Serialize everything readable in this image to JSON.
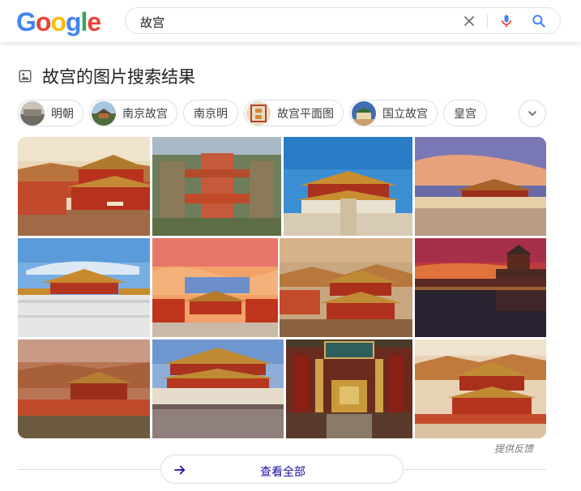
{
  "logo": {
    "letters": [
      "G",
      "o",
      "o",
      "g",
      "l",
      "e"
    ],
    "colors": [
      "#4285F4",
      "#EA4335",
      "#FBBC05",
      "#4285F4",
      "#34A853",
      "#EA4335"
    ]
  },
  "search": {
    "query": "故宫"
  },
  "section": {
    "title": "故宫的图片搜索结果"
  },
  "chips": [
    {
      "label": "明朝",
      "has_thumb": true
    },
    {
      "label": "南京故宫",
      "has_thumb": true
    },
    {
      "label": "南京明",
      "has_thumb": false
    },
    {
      "label": "故宫平面图",
      "has_thumb": true
    },
    {
      "label": "国立故宫",
      "has_thumb": true
    },
    {
      "label": "皇宫",
      "has_thumb": false
    }
  ],
  "images": {
    "plaque_text": "皇極建有"
  },
  "footer": {
    "feedback": "提供反馈",
    "view_all": "查看全部"
  },
  "colors": {
    "link": "#1a0dab",
    "border": "#dadce0",
    "mic_blue": "#4285F4",
    "mic_red": "#EA4335"
  }
}
